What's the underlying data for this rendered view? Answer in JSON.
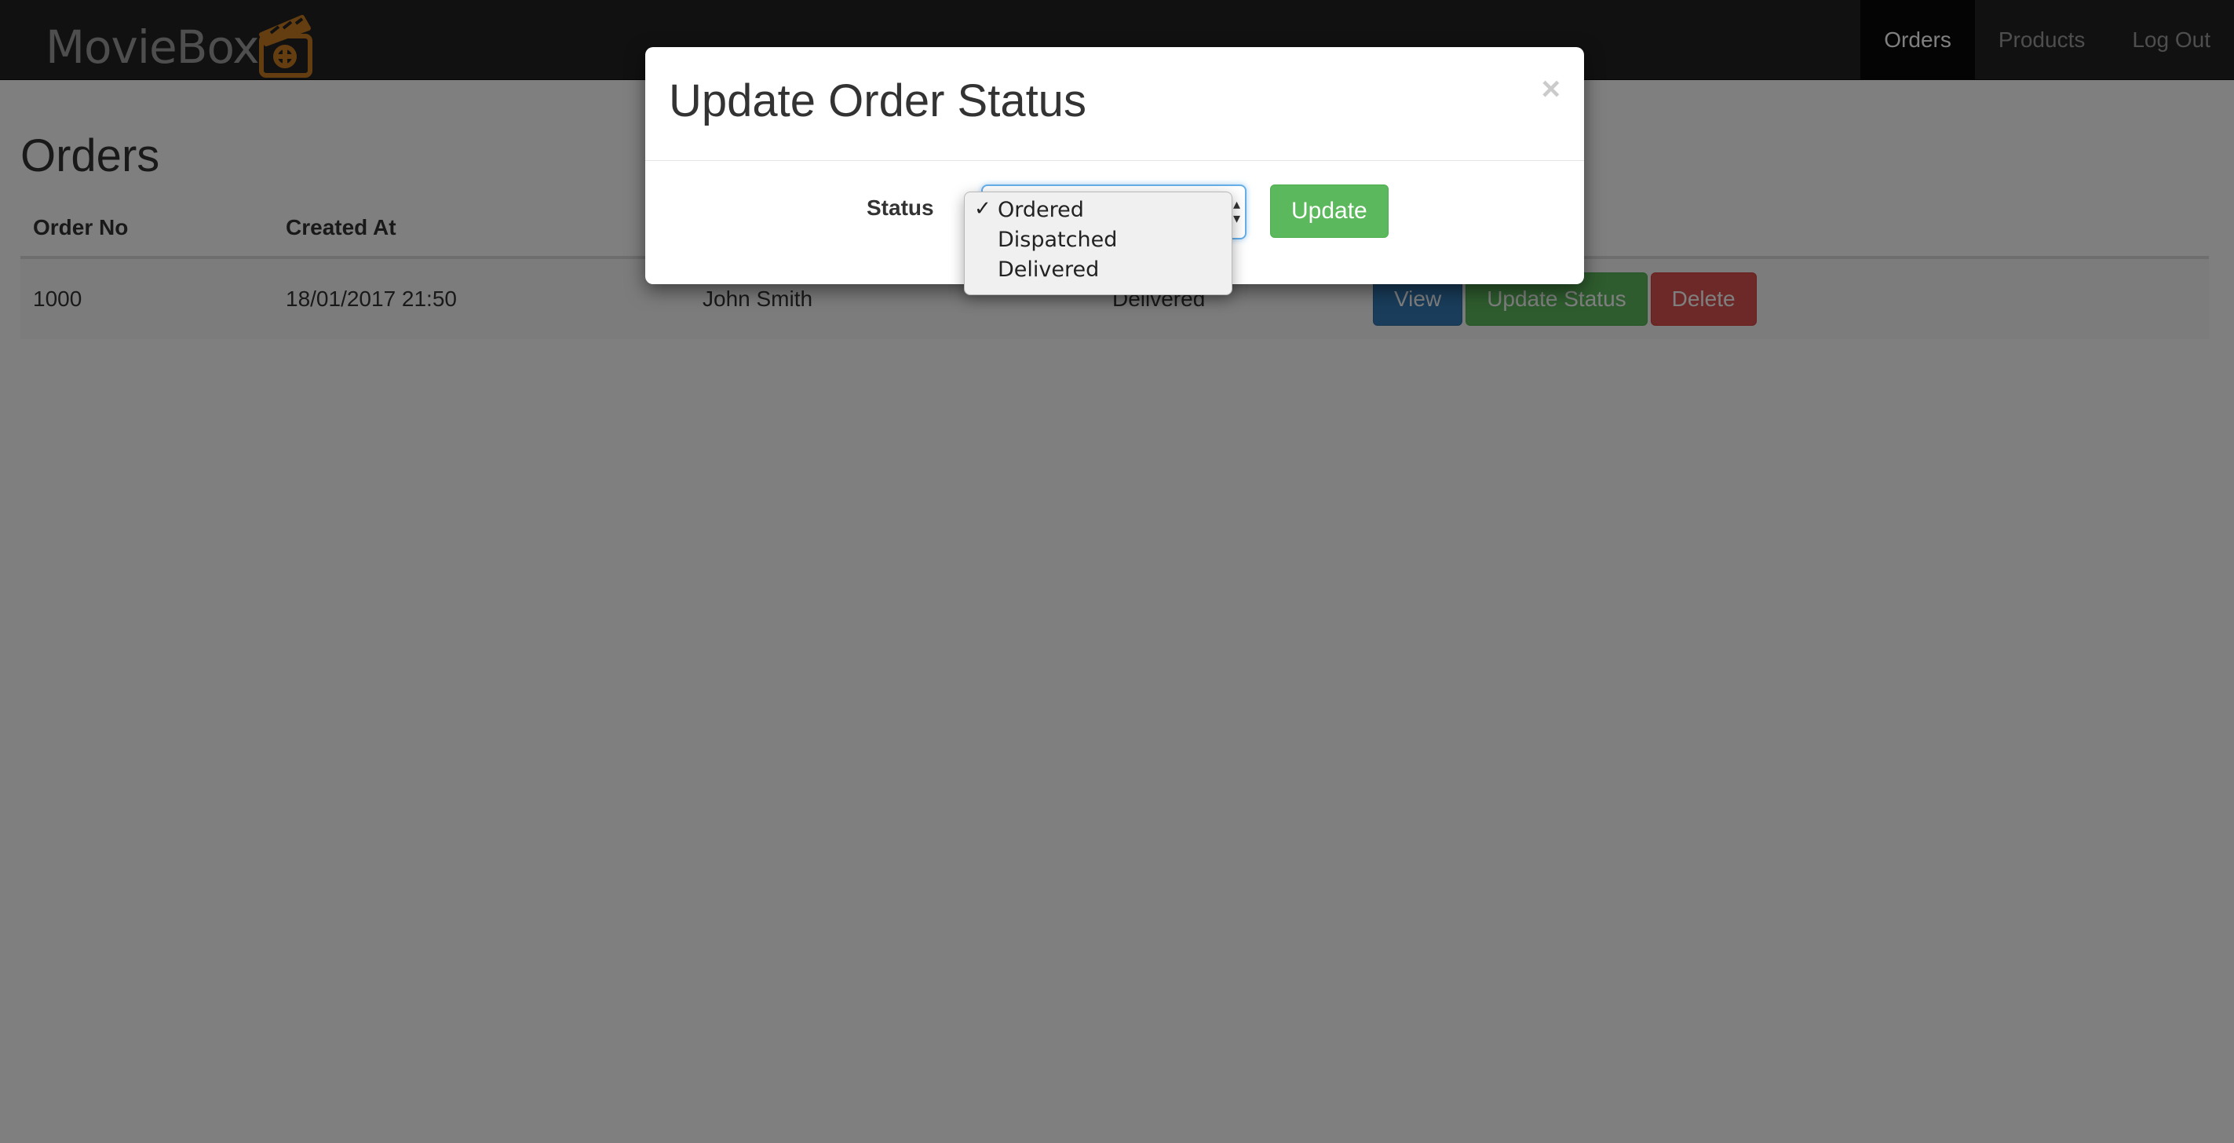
{
  "navbar": {
    "brand": "MovieBox",
    "items": [
      {
        "label": "Orders",
        "active": true
      },
      {
        "label": "Products",
        "active": false
      },
      {
        "label": "Log Out",
        "active": false
      }
    ]
  },
  "page": {
    "title": "Orders",
    "columns": [
      "Order No",
      "Created At",
      "",
      "",
      ""
    ],
    "rows": [
      {
        "order_no": "1000",
        "created_at": "18/01/2017 21:50",
        "customer": "John Smith",
        "status": "Delivered"
      }
    ],
    "actions": {
      "view": "View",
      "update_status": "Update Status",
      "delete": "Delete"
    }
  },
  "modal": {
    "title": "Update Order Status",
    "close": "×",
    "status_label": "Status",
    "update_button": "Update",
    "select": {
      "selected": "Ordered",
      "options": [
        "Ordered",
        "Dispatched",
        "Delivered"
      ]
    }
  },
  "colors": {
    "primary": "#337ab7",
    "success": "#5cb85c",
    "danger": "#d9534f",
    "brand_logo": "#c87d23"
  }
}
